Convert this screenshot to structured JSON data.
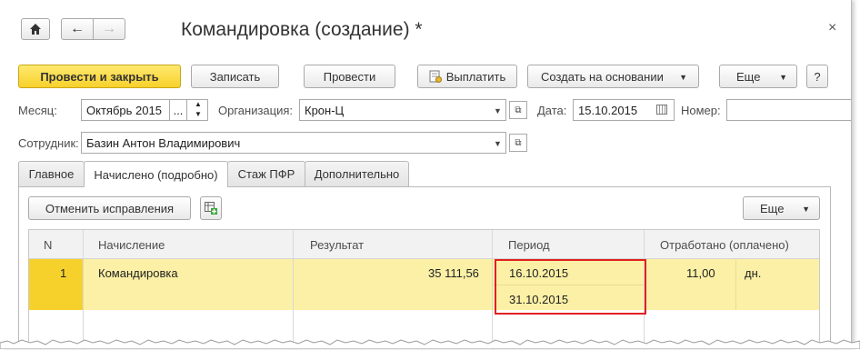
{
  "window": {
    "title": "Командировка (создание) *",
    "close_glyph": "×"
  },
  "nav": {
    "home_glyph": "⌂",
    "back_glyph": "←",
    "forward_glyph": "→"
  },
  "toolbar": {
    "post_close_label": "Провести и закрыть",
    "save_label": "Записать",
    "post_label": "Провести",
    "pay_label": "Выплатить",
    "create_based_label": "Создать на основании",
    "more_label": "Еще",
    "help_label": "?"
  },
  "form": {
    "month_label": "Месяц:",
    "month_value": "Октябрь 2015",
    "month_dots": "...",
    "org_label": "Организация:",
    "org_value": "Крон-Ц",
    "date_label": "Дата:",
    "date_value": "15.10.2015",
    "number_label": "Номер:",
    "number_value": "",
    "employee_label": "Сотрудник:",
    "employee_value": "Базин Антон Владимирович"
  },
  "tabs": [
    {
      "label": "Главное"
    },
    {
      "label": "Начислено (подробно)"
    },
    {
      "label": "Стаж ПФР"
    },
    {
      "label": "Дополнительно"
    }
  ],
  "table_toolbar": {
    "cancel_corrections_label": "Отменить исправления",
    "more_label": "Еще"
  },
  "table": {
    "columns": [
      "N",
      "Начисление",
      "Результат",
      "Период",
      "Отработано (оплачено)"
    ],
    "rows": [
      {
        "n": "1",
        "accrual": "Командировка",
        "result": "35 111,56",
        "period_start": "16.10.2015",
        "period_end": "31.10.2015",
        "worked": "11,00",
        "unit": "дн."
      }
    ]
  },
  "colors": {
    "primary_button": "#f7d12b",
    "selected_row": "#fbf0a5",
    "selected_cell": "#f7d12b",
    "highlight_border": "#e02020"
  }
}
